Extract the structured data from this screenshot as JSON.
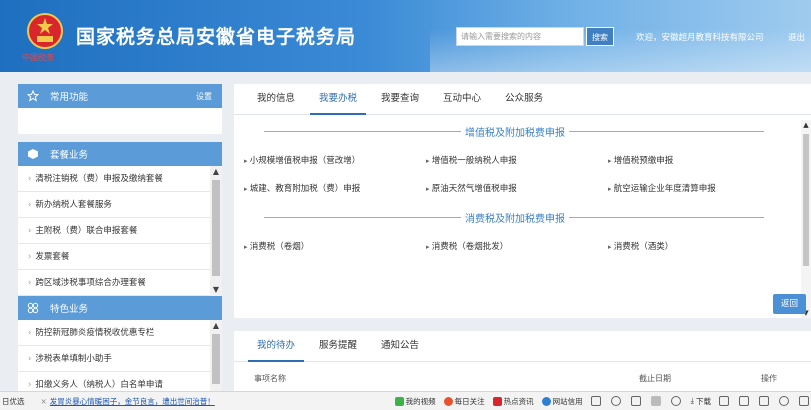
{
  "header": {
    "title": "国家税务总局安徽省电子税务局",
    "logo_caption": "中国税务",
    "search_placeholder": "请输入需要搜索的内容",
    "search_btn": "搜索",
    "welcome": "欢迎，安徽超月教育科技有限公司",
    "logout": "退出"
  },
  "sidebar": {
    "common": {
      "title": "常用功能",
      "setting": "设置"
    },
    "package": {
      "title": "套餐业务",
      "items": [
        "清税注销税（费）申报及缴纳套餐",
        "新办纳税人套餐服务",
        "主附税（费）联合申报套餐",
        "发票套餐",
        "跨区域涉税事项综合办理套餐"
      ]
    },
    "special": {
      "title": "特色业务",
      "items": [
        "防控新冠肺炎疫情税收优惠专栏",
        "涉税表单填制小助手",
        "扣缴义务人（纳税人）白名单申请"
      ]
    }
  },
  "main": {
    "tabs": [
      "我的信息",
      "我要办税",
      "我要查询",
      "互动中心",
      "公众服务"
    ],
    "active_tab": 1,
    "sections": [
      {
        "title": "增值税及附加税费申报",
        "items": [
          "小规模增值税申报（营改增）",
          "增值税一般纳税人申报",
          "增值税预缴申报",
          "城建、教育附加税（费）申报",
          "原油天然气增值税申报",
          "航空运输企业年度清算申报"
        ]
      },
      {
        "title": "消费税及附加税费申报",
        "items": [
          "消费税（卷烟）",
          "消费税（卷烟批发）",
          "消费税（酒类）"
        ]
      }
    ],
    "back_btn": "返回"
  },
  "todo": {
    "tabs": [
      "我的待办",
      "服务提醒",
      "通知公告"
    ],
    "active_tab": 0,
    "headers": {
      "name": "事项名称",
      "deadline": "截止日期",
      "action": "操作"
    }
  },
  "taskbar": {
    "left": "日优选",
    "news": "发胃炎暴心情暖困子，金节良言，遭出世间治普！",
    "items": [
      "我的视频",
      "每日关注",
      "热点资讯",
      "网站信用"
    ],
    "download": "下载"
  }
}
